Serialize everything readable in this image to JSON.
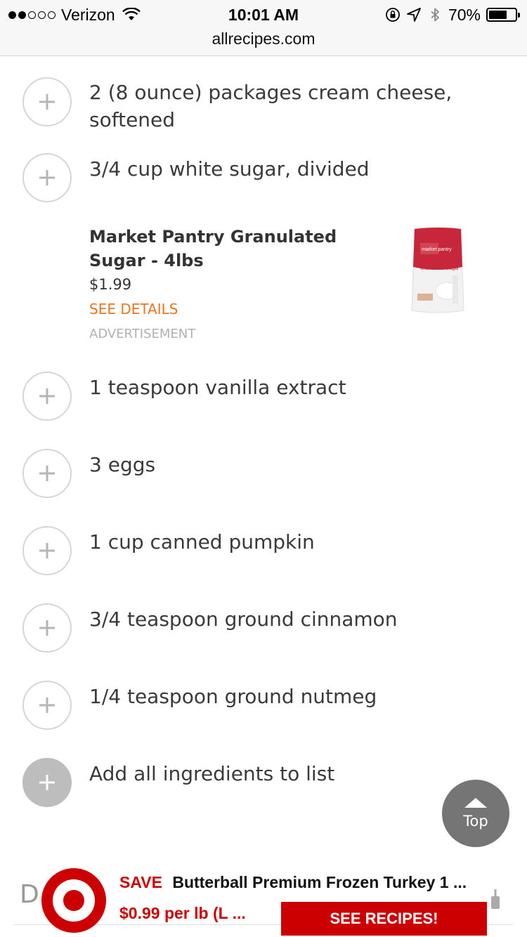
{
  "status_bar": {
    "carrier": "Verizon",
    "time": "10:01 AM",
    "battery": "70%",
    "battery_level": 0.7,
    "signal_bars_filled": 2,
    "signal_bars_total": 5
  },
  "address_bar": {
    "domain": "allrecipes.com"
  },
  "ingredients": [
    {
      "text": "2 (8 ounce) packages cream cheese, softened"
    },
    {
      "text": "3/4 cup white sugar, divided"
    },
    {
      "text": "1 teaspoon vanilla extract"
    },
    {
      "text": "3 eggs"
    },
    {
      "text": "1 cup canned pumpkin"
    },
    {
      "text": "3/4 teaspoon ground cinnamon"
    },
    {
      "text": "1/4 teaspoon ground nutmeg"
    }
  ],
  "add_all": {
    "label": "Add all ingredients to list"
  },
  "ad": {
    "title": "Market Pantry Granulated Sugar - 4lbs",
    "price": "$1.99",
    "details_link": "SEE DETAILS",
    "label": "ADVERTISEMENT",
    "product_brand": "market pantry",
    "product_name": "Granulated Sugar"
  },
  "top_button": {
    "label": "Top"
  },
  "banner": {
    "partial_letter": "D",
    "save": "SAVE",
    "product": "Butterball Premium Frozen Turkey 1 ...",
    "price": "$0.99 per lb (L ...",
    "cta": "SEE RECIPES!"
  },
  "colors": {
    "accent_orange": "#e87722",
    "target_red": "#cc0000",
    "top_button_gray": "#757575"
  },
  "icons": {
    "ingredient_add": "plus-icon",
    "wifi": "wifi-icon",
    "lock_rotation": "rotation-lock-icon",
    "location": "location-arrow-icon",
    "bluetooth": "bluetooth-icon",
    "top_arrow": "up-arrow-icon",
    "share": "share-icon"
  }
}
